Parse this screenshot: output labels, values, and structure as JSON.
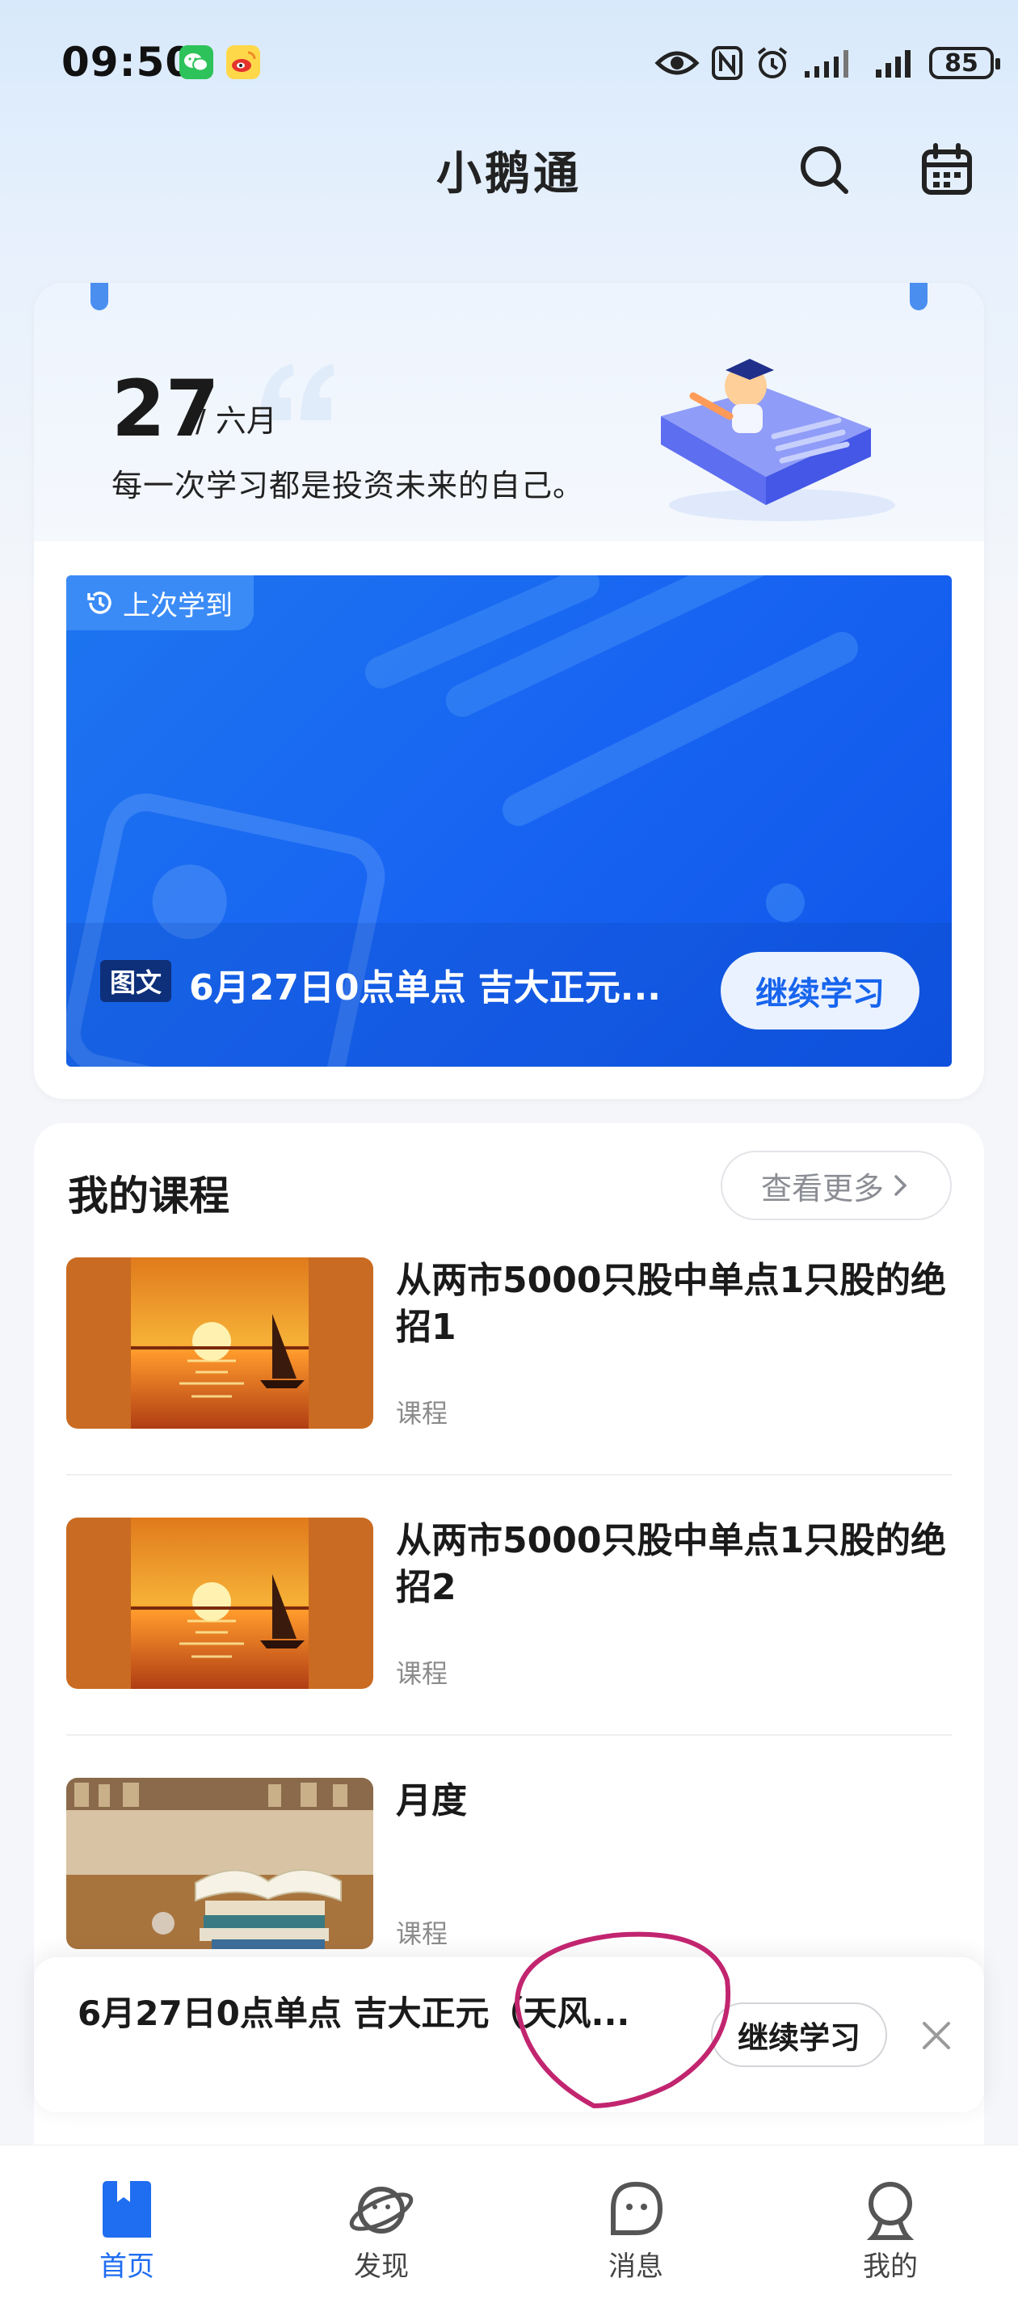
{
  "status_bar": {
    "time": "09:50",
    "battery": "85"
  },
  "header": {
    "title": "小鹅通"
  },
  "date_card": {
    "day": "27",
    "month": "/ 六月",
    "quote": "每一次学习都是投资未来的自己。"
  },
  "last_study": {
    "tag": "上次学到",
    "type_badge": "图文",
    "title": "6月27日0点单点 吉大正元...",
    "continue_label": "继续学习"
  },
  "my_courses": {
    "title": "我的课程",
    "more_label": "查看更多",
    "items": [
      {
        "name": "从两市5000只股中单点1只股的绝招1",
        "kind": "课程"
      },
      {
        "name": "从两市5000只股中单点1只股的绝招2",
        "kind": "课程"
      },
      {
        "name": "月度",
        "kind": "课程"
      }
    ]
  },
  "mini_player": {
    "title": "6月27日0点单点 吉大正元（天风...",
    "continue_label": "继续学习"
  },
  "tabs": [
    {
      "label": "首页",
      "icon": "book-icon",
      "active": true
    },
    {
      "label": "发现",
      "icon": "planet-icon",
      "active": false
    },
    {
      "label": "消息",
      "icon": "message-icon",
      "active": false
    },
    {
      "label": "我的",
      "icon": "profile-icon",
      "active": false
    }
  ],
  "colors": {
    "accent": "#1f6df0",
    "banner": "#1864f2",
    "annotation": "#c2256f"
  }
}
